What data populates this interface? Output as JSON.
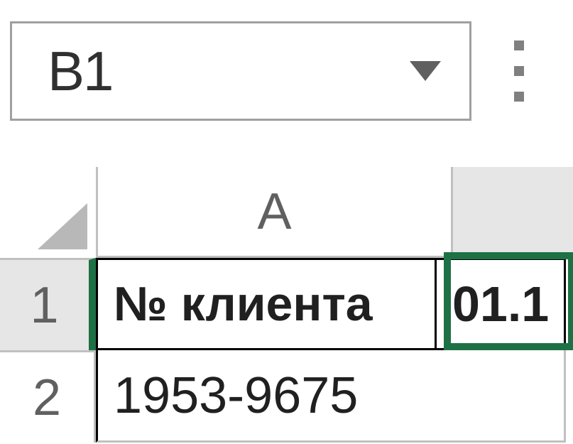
{
  "nameBox": {
    "value": "B1"
  },
  "columns": {
    "a": "A",
    "b": ""
  },
  "rows": {
    "r1": "1",
    "r2": "2"
  },
  "cells": {
    "a1": "№ клиента",
    "b1": "01.1",
    "a2": "1953-9675",
    "b2": ""
  }
}
